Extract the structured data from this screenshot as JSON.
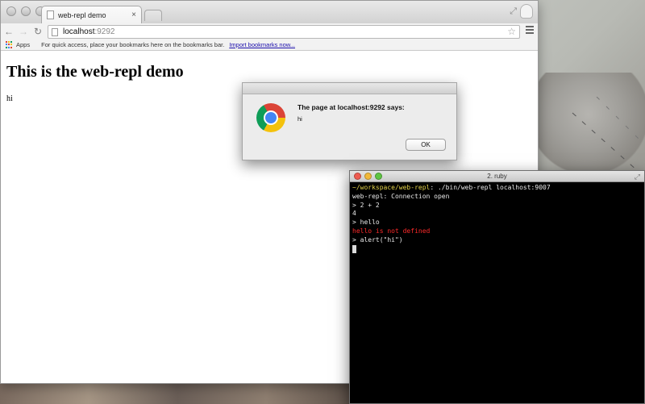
{
  "browser": {
    "tab_title": "web-repl demo",
    "tab_close": "×",
    "address_host": "localhost",
    "address_port": ":9292",
    "bookmarks_apps": "Apps",
    "bookmarks_hint": "For quick access, place your bookmarks here on the bookmarks bar.",
    "bookmarks_import": "Import bookmarks now...",
    "icons": [
      "back-arrow-icon",
      "forward-arrow-icon",
      "reload-icon",
      "star-icon",
      "menu-icon",
      "apps-icon"
    ]
  },
  "page": {
    "heading": "This is the web-repl demo",
    "body_text": "hi"
  },
  "alert": {
    "heading": "The page at localhost:9292 says:",
    "message": "hi",
    "ok_label": "OK"
  },
  "terminal": {
    "title": "2. ruby",
    "prompt_path": "~/workspace/web-repl",
    "command": ": ./bin/web-repl localhost:9007",
    "lines": [
      "web-repl: Connection open",
      "> 2 + 2",
      "4",
      "> hello",
      "hello is not defined",
      "> alert(\"hi\")"
    ],
    "colors": {
      "prompt": "#e3d24a",
      "error": "#ff2a2a",
      "text": "#e8e8e8"
    }
  }
}
